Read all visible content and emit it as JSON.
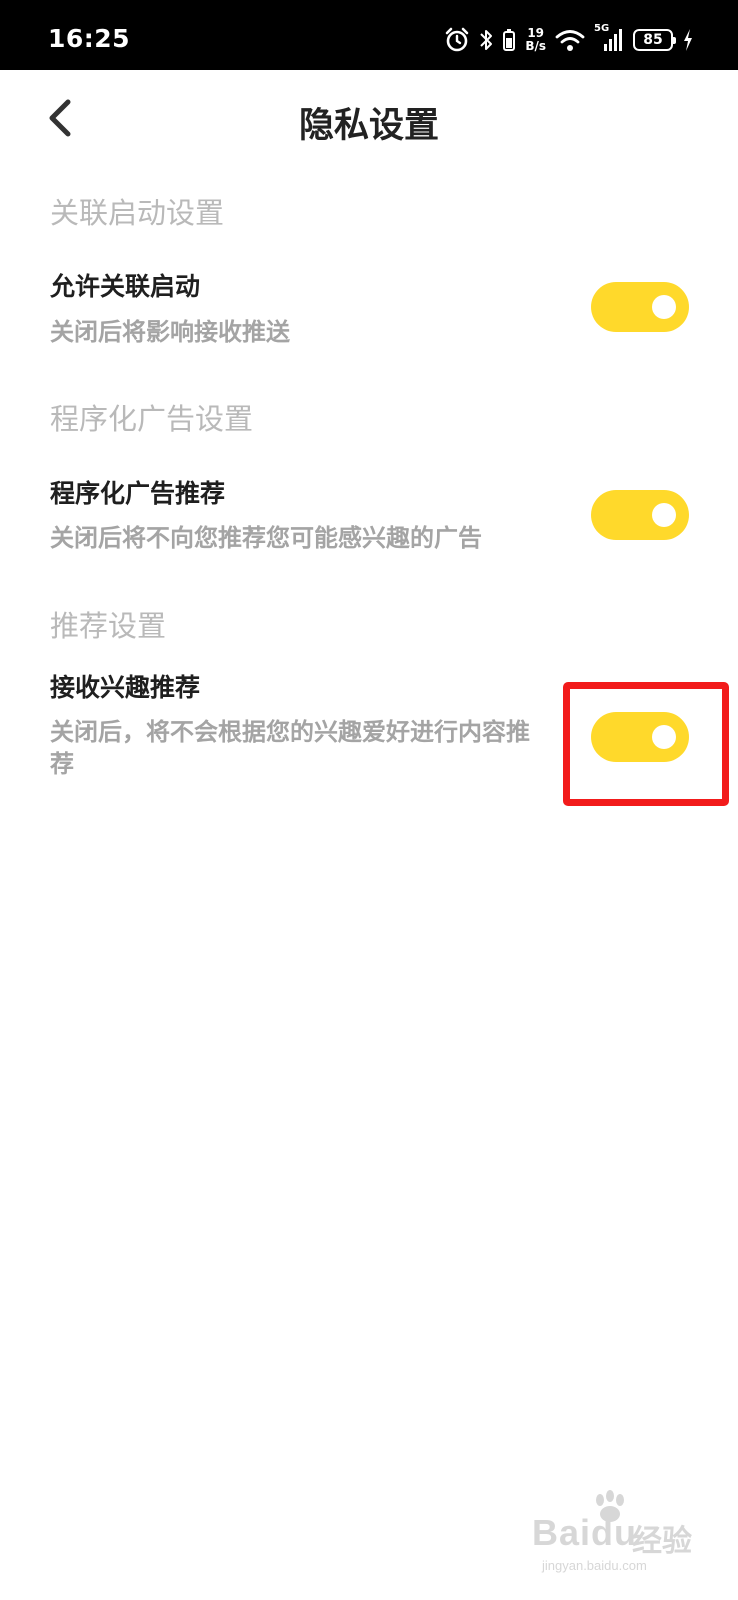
{
  "status_bar": {
    "time": "16:25",
    "net_speed_value": "19",
    "net_speed_unit": "B/s",
    "network_type": "5G",
    "battery": "85"
  },
  "header": {
    "title": "隐私设置"
  },
  "sections": [
    {
      "title": "关联启动设置",
      "item": {
        "title": "允许关联启动",
        "desc": "关闭后将影响接收推送",
        "enabled": true
      }
    },
    {
      "title": "程序化广告设置",
      "item": {
        "title": "程序化广告推荐",
        "desc": "关闭后将不向您推荐您可能感兴趣的广告",
        "enabled": true
      }
    },
    {
      "title": "推荐设置",
      "item": {
        "title": "接收兴趣推荐",
        "desc": "关闭后，将不会根据您的兴趣爱好进行内容推荐",
        "enabled": true
      }
    }
  ],
  "colors": {
    "toggle_on": "#ffd92b",
    "highlight": "#f21b1b"
  },
  "watermark": {
    "logo": "Baidu",
    "text": "经验",
    "url": "jingyan.baidu.com"
  }
}
